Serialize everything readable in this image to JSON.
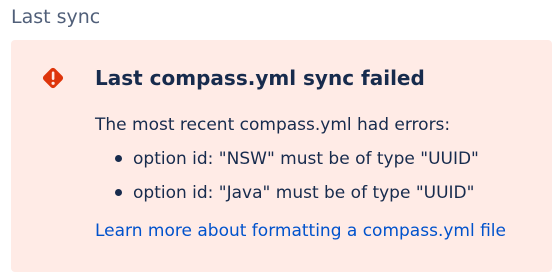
{
  "section": {
    "heading": "Last sync"
  },
  "banner": {
    "icon": "error-icon",
    "title": "Last compass.yml sync failed",
    "description": "The most recent compass.yml had errors:",
    "errors": [
      "option id: \"NSW\" must be of type \"UUID\"",
      "option id: \"Java\" must be of type \"UUID\""
    ],
    "link_label": "Learn more about formatting a compass.yml file"
  },
  "colors": {
    "banner_background": "#ffebe6",
    "error_red": "#de350b",
    "text": "#172b4d",
    "link": "#0052cc",
    "heading": "#505f79"
  }
}
